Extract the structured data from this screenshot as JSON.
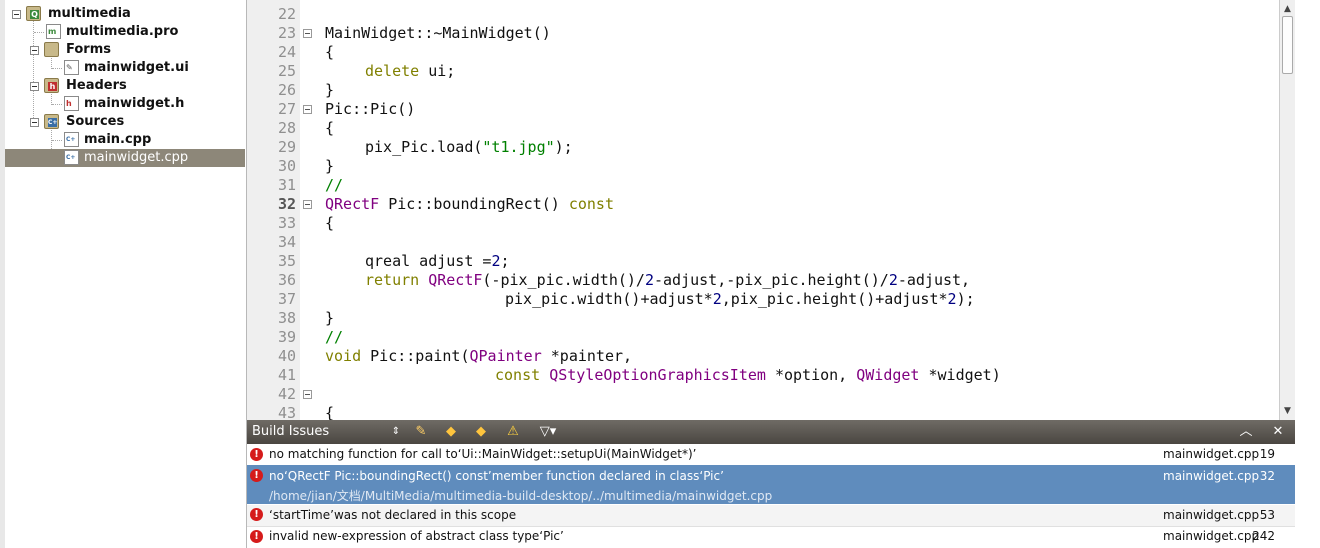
{
  "project_tree": {
    "root": "multimedia",
    "items": [
      {
        "label": "multimedia.pro"
      },
      {
        "label": "Forms"
      },
      {
        "label": "mainwidget.ui"
      },
      {
        "label": "Headers"
      },
      {
        "label": "mainwidget.h"
      },
      {
        "label": "Sources"
      },
      {
        "label": "main.cpp"
      },
      {
        "label": "mainwidget.cpp"
      }
    ]
  },
  "editor": {
    "lines": [
      {
        "n": "22"
      },
      {
        "n": "23"
      },
      {
        "n": "24"
      },
      {
        "n": "25"
      },
      {
        "n": "26"
      },
      {
        "n": "27"
      },
      {
        "n": "28"
      },
      {
        "n": "29"
      },
      {
        "n": "30"
      },
      {
        "n": "31"
      },
      {
        "n": "32"
      },
      {
        "n": "33"
      },
      {
        "n": "34"
      },
      {
        "n": "35"
      },
      {
        "n": "36"
      },
      {
        "n": "37"
      },
      {
        "n": "38"
      },
      {
        "n": "39"
      },
      {
        "n": "40"
      },
      {
        "n": "41"
      },
      {
        "n": "42"
      },
      {
        "n": "43"
      }
    ],
    "code": {
      "l23": "MainWidget::~MainWidget()",
      "l24": "{",
      "l25_kw": "delete",
      "l25_rest": " ui;",
      "l26": "}",
      "l27": "Pic::Pic()",
      "l28": "{",
      "l29_a": "pix_Pic.load(",
      "l29_str": "\"t1.jpg\"",
      "l29_b": ");",
      "l30": "}",
      "l31": "//",
      "l32_ty": "QRectF",
      "l32_mid": " Pic::boundingRect() ",
      "l32_kw": "const",
      "l33": "{",
      "l35_a": "qreal adjust =",
      "l35_num": "2",
      "l35_b": ";",
      "l36_kw": "return",
      "l36_sp": " ",
      "l36_ty": "QRectF",
      "l36_a": "(-pix_pic.width()/",
      "l36_n1": "2",
      "l36_b": "-adjust,-pix_pic.height()/",
      "l36_n2": "2",
      "l36_c": "-adjust,",
      "l37_a": "pix_pic.width()+adjust*",
      "l37_n1": "2",
      "l37_b": ",pix_pic.height()+adjust*",
      "l37_n2": "2",
      "l37_c": ");",
      "l38": "}",
      "l39": "//",
      "l40_kw": "void",
      "l40_a": " Pic::paint(",
      "l40_ty": "QPainter",
      "l40_b": " *painter,",
      "l41_kw": "const",
      "l41_sp": " ",
      "l41_ty1": "QStyleOptionGraphicsItem",
      "l41_a": " *option, ",
      "l41_ty2": "QWidget",
      "l41_b": " *widget)",
      "l43": "{"
    }
  },
  "build_issues": {
    "title": "Build Issues",
    "issues": [
      {
        "message": "no matching function for call to‘Ui::MainWidget::setupUi(MainWidget*)’",
        "file": "mainwidget.cpp",
        "line": "19"
      },
      {
        "message": "no‘QRectF Pic::boundingRect() const’member function declared in class‘Pic’",
        "path": "/home/jian/文档/MultiMedia/multimedia-build-desktop/../multimedia/mainwidget.cpp",
        "file": "mainwidget.cpp",
        "line": "32"
      },
      {
        "message": "‘startTime’was not declared in this scope",
        "file": "mainwidget.cpp",
        "line": "53"
      },
      {
        "message": "invalid new-expression of abstract class type‘Pic’",
        "file": "mainwidget.cpp",
        "line": "242"
      }
    ]
  },
  "colors": {
    "selected_tree_item": "#8d8779",
    "selected_issue": "#5f8cbd",
    "keyword": "#808000",
    "type": "#800080",
    "string": "#008000",
    "error": "#d51b1b"
  },
  "icons": [
    "tree-toggle-icon",
    "project-folder-icon",
    "pro-file-icon",
    "forms-folder-icon",
    "ui-file-icon",
    "headers-folder-icon",
    "h-file-icon",
    "sources-folder-icon",
    "cpp-file-icon",
    "fold-marker-icon",
    "updown-icon",
    "filter-icon",
    "arrow-left-icon",
    "arrow-right-icon",
    "warning-icon",
    "funnel-icon",
    "collapse-icon",
    "close-icon",
    "error-icon"
  ]
}
